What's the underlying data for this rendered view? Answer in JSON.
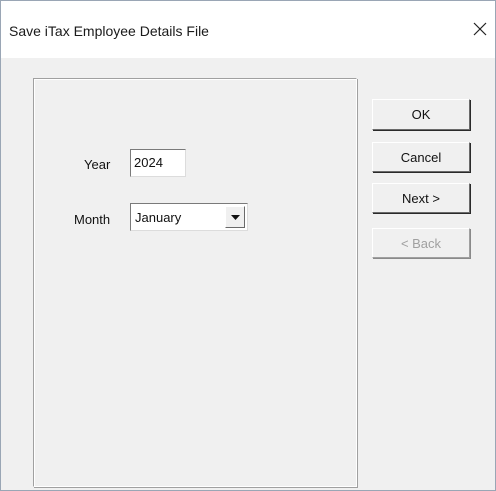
{
  "window": {
    "title": "Save iTax Employee Details File"
  },
  "form": {
    "year_label": "Year",
    "year_value": "2024",
    "month_label": "Month",
    "month_value": "January"
  },
  "buttons": {
    "ok": "OK",
    "cancel": "Cancel",
    "next": "Next >",
    "back": "< Back"
  },
  "icons": {
    "close": "close-icon",
    "dropdown": "triangle-down-icon"
  }
}
